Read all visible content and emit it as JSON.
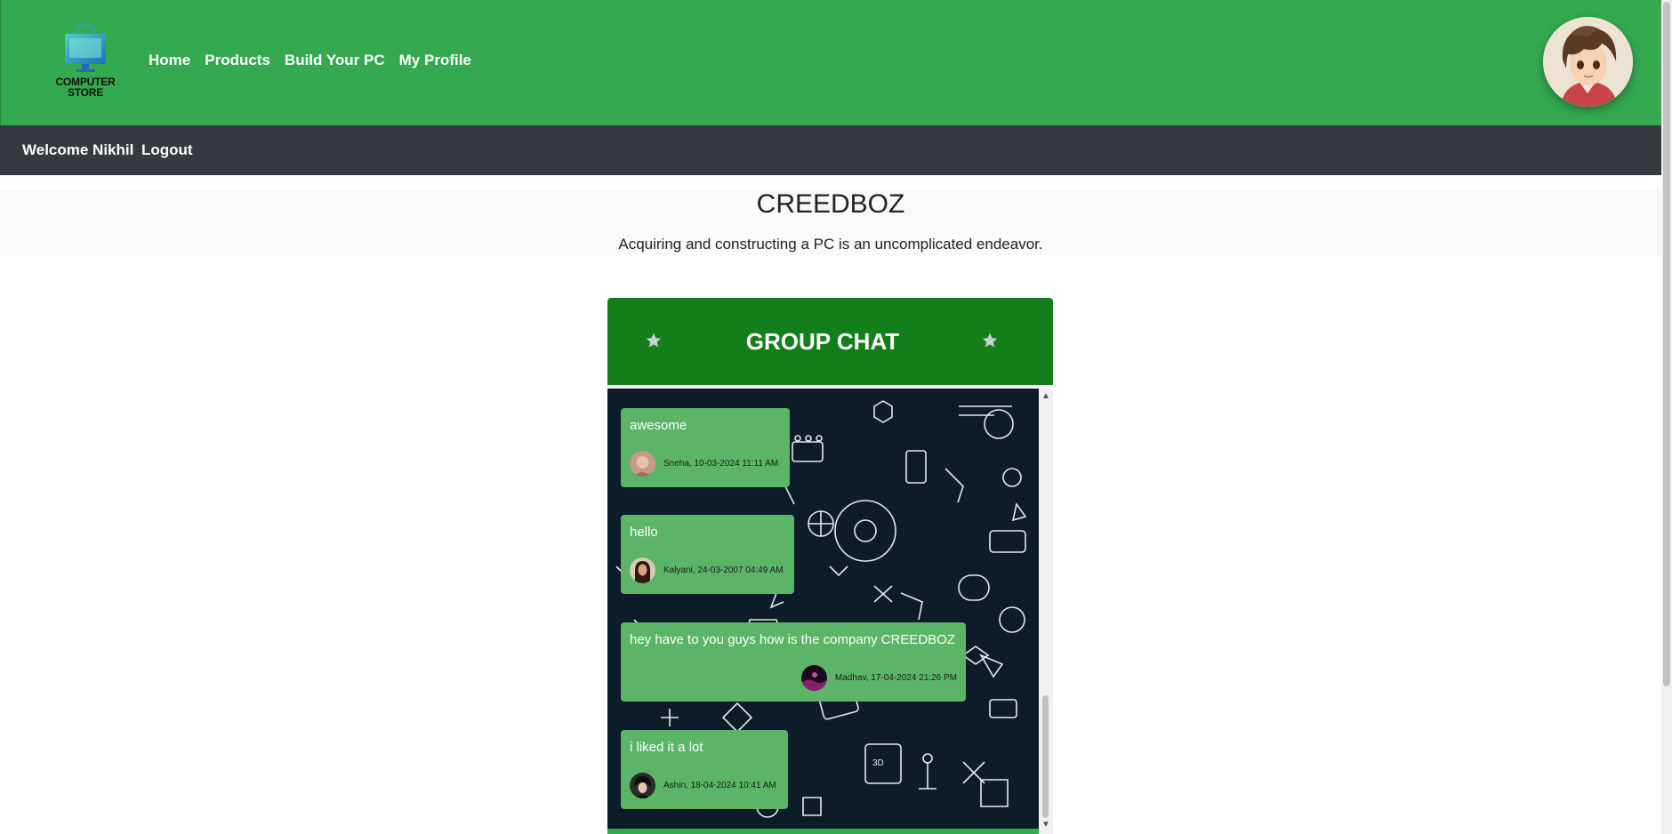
{
  "header": {
    "logo_text_line1": "COMPUTER",
    "logo_text_line2": "STORE",
    "nav": [
      "Home",
      "Products",
      "Build Your PC",
      "My Profile"
    ],
    "accent_color": "#34a94f"
  },
  "subbar": {
    "welcome": "Welcome Nikhil",
    "logout": "Logout",
    "color": "#343a40"
  },
  "hero": {
    "brand": "CREEDBOZ",
    "tagline": "Acquiring and constructing a PC is an uncomplicated endeavor."
  },
  "chat": {
    "title": "GROUP CHAT",
    "header_color": "#137f1b",
    "messages": [
      {
        "text": "awesome",
        "meta": "Sneha, 10-03-2024 11:11 AM",
        "avatar": "sneha-avatar"
      },
      {
        "text": "hello",
        "meta": "Kalyani, 24-03-2007 04:49 AM",
        "avatar": "kalyani-avatar"
      },
      {
        "text": "hey have to you guys how is the company CREEDBOZ",
        "meta": "Madhav, 17-04-2024 21:26 PM",
        "avatar": "madhav-avatar"
      },
      {
        "text": "i liked it a lot",
        "meta": "Ashin, 18-04-2024 10:41 AM",
        "avatar": "ashin-avatar"
      }
    ]
  }
}
